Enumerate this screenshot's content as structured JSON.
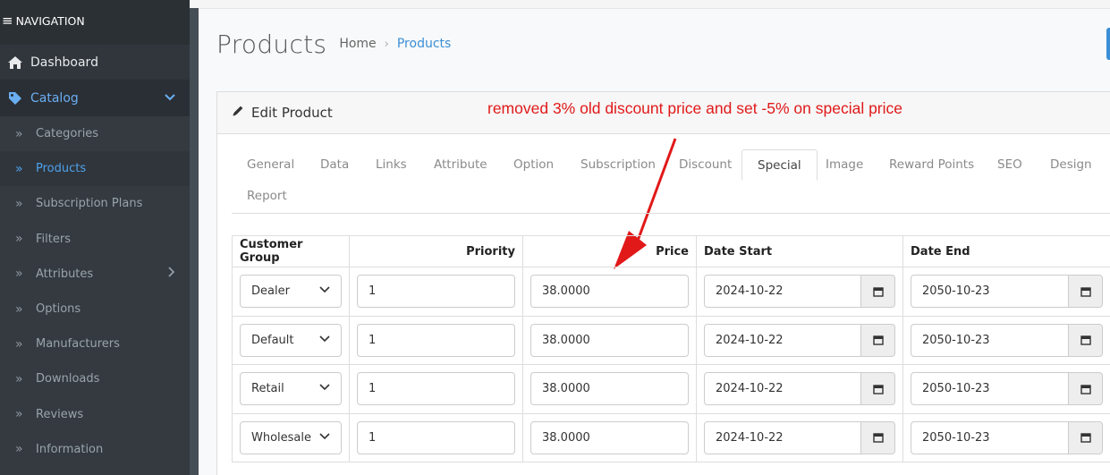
{
  "sidebar": {
    "header": "NAVIGATION",
    "items": [
      {
        "label": "Dashboard"
      },
      {
        "label": "Catalog"
      }
    ],
    "catalog_sub": [
      {
        "label": "Categories"
      },
      {
        "label": "Products"
      },
      {
        "label": "Subscription Plans"
      },
      {
        "label": "Filters"
      },
      {
        "label": "Attributes"
      },
      {
        "label": "Options"
      },
      {
        "label": "Manufacturers"
      },
      {
        "label": "Downloads"
      },
      {
        "label": "Reviews"
      },
      {
        "label": "Information"
      }
    ]
  },
  "header": {
    "title": "Products",
    "breadcrumb": [
      "Home",
      "Products"
    ]
  },
  "card": {
    "title": "Edit Product",
    "annotation": "removed 3% old discount price and set -5% on special price"
  },
  "tabs": [
    {
      "label": "General"
    },
    {
      "label": "Data"
    },
    {
      "label": "Links"
    },
    {
      "label": "Attribute"
    },
    {
      "label": "Option"
    },
    {
      "label": "Subscription"
    },
    {
      "label": "Discount"
    },
    {
      "label": "Special"
    },
    {
      "label": "Image"
    },
    {
      "label": "Reward Points"
    },
    {
      "label": "SEO"
    },
    {
      "label": "Design"
    },
    {
      "label": "Report"
    }
  ],
  "active_tab": "Special",
  "table": {
    "headers": [
      "Customer Group",
      "Priority",
      "Price",
      "Date Start",
      "Date End"
    ],
    "rows": [
      {
        "group": "Dealer",
        "priority": "1",
        "price": "38.0000",
        "date_start": "2024-10-22",
        "date_end": "2050-10-23"
      },
      {
        "group": "Default",
        "priority": "1",
        "price": "38.0000",
        "date_start": "2024-10-22",
        "date_end": "2050-10-23"
      },
      {
        "group": "Retail",
        "priority": "1",
        "price": "38.0000",
        "date_start": "2024-10-22",
        "date_end": "2050-10-23"
      },
      {
        "group": "Wholesale",
        "priority": "1",
        "price": "38.0000",
        "date_start": "2024-10-22",
        "date_end": "2050-10-23"
      }
    ]
  },
  "colors": {
    "sidebar_bg": "#343a40",
    "accent": "#3b8fd6",
    "annotation": "#e11919"
  }
}
